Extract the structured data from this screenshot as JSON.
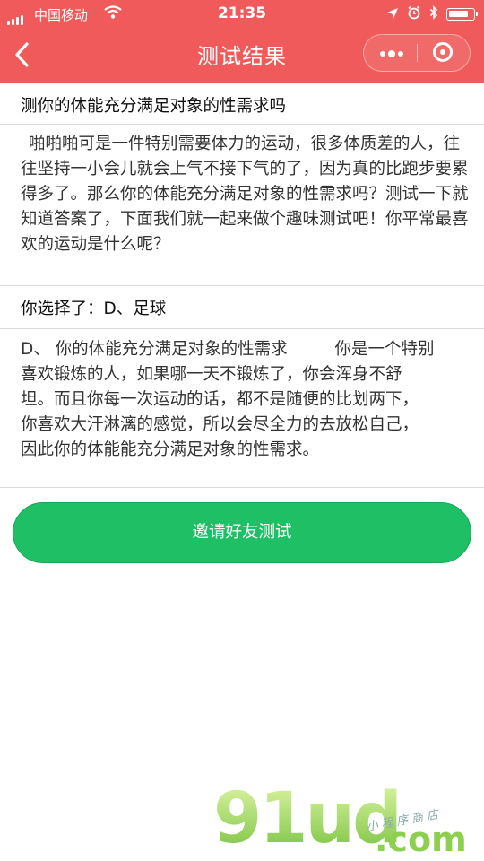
{
  "status_bar": {
    "carrier": "中国移动",
    "time": "21:35",
    "battery_level": 0.85
  },
  "nav": {
    "title": "测试结果",
    "icons": {
      "back": "chevron-left-icon",
      "more": "more-dots-icon",
      "close": "target-circle-icon"
    }
  },
  "question": {
    "title": "测你的体能充分满足对象的性需求吗",
    "description": "啪啪啪可是一件特别需要体力的运动，很多体质差的人，往往坚持一小会儿就会上气不接下气的了，因为真的比跑步要累得多了。那么你的体能充分满足对象的性需求吗？测试一下就知道答案了，下面我们就一起来做个趣味测试吧！你平常最喜欢的运动是什么呢？"
  },
  "choice": {
    "label": "你选择了：D、足球"
  },
  "result": {
    "lines": [
      "D、 你的体能充分满足对象的性需求         你是一个特别",
      "喜欢锻炼的人，如果哪一天不锻炼了，你会浑身不舒",
      "坦。而且你每一次运动的话，都不是随便的比划两下，",
      "你喜欢大汗淋漓的感觉，所以会尽全力的去放松自己，",
      "因此你的体能能充分满足对象的性需求。"
    ]
  },
  "actions": {
    "invite_label": "邀请好友测试"
  },
  "watermark": {
    "main": "91ud",
    "domain": ".com",
    "sub": "小程序商店"
  },
  "colors": {
    "nav_bg": "#f05a5a",
    "button_bg": "#1fbf66",
    "watermark": "#8dd050"
  }
}
